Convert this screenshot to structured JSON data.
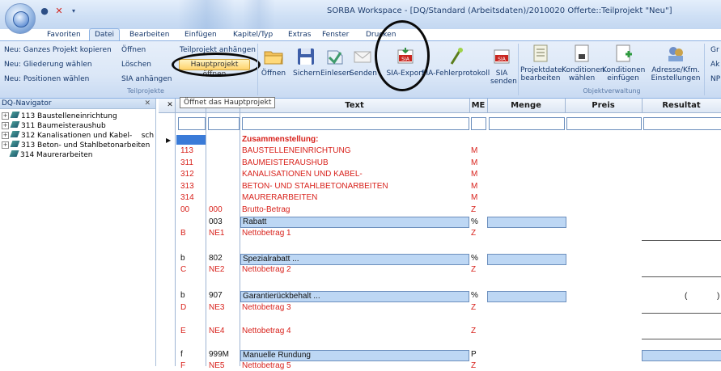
{
  "window": {
    "title": "SORBA Workspace - [DQ/Standard (Arbeitsdaten)/2010020 Offerte::Teilprojekt \"Neu\"]",
    "icons": [
      "app-orb-icon",
      "quick-save-icon",
      "close-icon",
      "dropdown-icon"
    ]
  },
  "tabs": [
    "Favoriten",
    "Datei",
    "Bearbeiten",
    "Einfügen",
    "Kapitel/Typ",
    "Extras",
    "Fenster",
    "Drucken"
  ],
  "active_tab": "Datei",
  "ribbon": {
    "teilprojekte": {
      "col1": [
        "Neu: Ganzes Projekt kopieren",
        "Neu: Gliederung wählen",
        "Neu: Positionen wählen"
      ],
      "col2": [
        "Öffnen",
        "Löschen",
        "SIA anhängen"
      ],
      "col3": [
        "Teilprojekt anhängen",
        "Hauptprojekt öffnen"
      ],
      "label": "Teilprojekte"
    },
    "buttons": [
      {
        "label": "Öffnen",
        "icon": "folder-open-icon"
      },
      {
        "label": "Sichern",
        "icon": "floppy-save-icon"
      },
      {
        "label": "Einlesen",
        "icon": "import-icon"
      },
      {
        "label": "Senden",
        "icon": "envelope-icon"
      },
      {
        "label": "SIA-Export",
        "icon": "sia-export-icon"
      },
      {
        "label": "SIA-Fehlerprotokoll",
        "icon": "magic-wand-icon"
      },
      {
        "label": "SIA senden",
        "icon": "sia-send-icon"
      }
    ],
    "objekt": {
      "buttons": [
        {
          "label": "Projektdatei bearbeiten",
          "icon": "project-file-icon"
        },
        {
          "label": "Konditionen wählen",
          "icon": "conditions-select-icon"
        },
        {
          "label": "Konditionen einfügen",
          "icon": "conditions-insert-icon"
        },
        {
          "label": "Adresse/Kfm. Einstellungen",
          "icon": "address-icon"
        }
      ],
      "label": "Objektverwaltung"
    },
    "cut_off": [
      "Gr",
      "Ak",
      "NP"
    ]
  },
  "tooltip": "Öffnet das Hauptprojekt",
  "navigator": {
    "title": "DQ-Navigator",
    "close": "✕",
    "items": [
      {
        "label": "113 Baustelleneinrichtung",
        "expander": "+"
      },
      {
        "label": "311 Baumeisteraushub",
        "expander": "+"
      },
      {
        "label": "312 Kanalisationen und Kabel-    sch",
        "expander": "+"
      },
      {
        "label": "313 Beton- und Stahlbetonarbeiten",
        "expander": "+"
      },
      {
        "label": "314 Maurerarbeiten",
        "expander": ""
      }
    ]
  },
  "grid": {
    "columns": {
      "text": "Text",
      "me": "ME",
      "menge": "Menge",
      "preis": "Preis",
      "resultat": "Resultat"
    },
    "rows": [
      {
        "c1": "",
        "c2": "",
        "text": "Zusammenstellung:",
        "me": "",
        "color": "red",
        "bold": true
      },
      {
        "c1": "113",
        "c2": "",
        "text": "BAUSTELLENEINRICHTUNG",
        "me": "M",
        "color": "red"
      },
      {
        "c1": "311",
        "c2": "",
        "text": "BAUMEISTERAUSHUB",
        "me": "M",
        "color": "red"
      },
      {
        "c1": "312",
        "c2": "",
        "text": "KANALISATIONEN UND KABEL-",
        "me": "M",
        "color": "red"
      },
      {
        "c1": "313",
        "c2": "",
        "text": "BETON- UND STAHLBETONARBEITEN",
        "me": "M",
        "color": "red"
      },
      {
        "c1": "314",
        "c2": "",
        "text": "MAURERARBEITEN",
        "me": "M",
        "color": "red"
      },
      {
        "c1": "00",
        "c2": "000",
        "text": "Brutto-Betrag",
        "me": "Z",
        "color": "red"
      },
      {
        "c1": "",
        "c2": "003",
        "text": "Rabatt",
        "me": "%",
        "color": "blk",
        "boxed": true
      },
      {
        "c1": "B",
        "c2": "NE1",
        "text": "Nettobetrag 1",
        "me": "Z",
        "color": "red"
      },
      {
        "c1": "b",
        "c2": "802",
        "text": "Spezialrabatt ...",
        "me": "%",
        "color": "blk",
        "boxed": true
      },
      {
        "c1": "C",
        "c2": "NE2",
        "text": "Nettobetrag 2",
        "me": "Z",
        "color": "red"
      },
      {
        "c1": "b",
        "c2": "907",
        "text": "Garantierückbehalt ...",
        "me": "%",
        "color": "blk",
        "boxed": true
      },
      {
        "c1": "D",
        "c2": "NE3",
        "text": "Nettobetrag 3",
        "me": "Z",
        "color": "red"
      },
      {
        "c1": "E",
        "c2": "NE4",
        "text": "Nettobetrag 4",
        "me": "Z",
        "color": "red"
      },
      {
        "c1": "f",
        "c2": "999M",
        "text": "Manuelle Rundung",
        "me": "P",
        "color": "blk",
        "boxed": true
      },
      {
        "c1": "F",
        "c2": "NE5",
        "text": "Nettobetrag 5",
        "me": "Z",
        "color": "red"
      }
    ],
    "paren_left": "(",
    "paren_right": ")"
  },
  "colors": {
    "red_text": "#d8221c",
    "highlight_cell": "#bdd7f4",
    "accent": "#8db2e3"
  }
}
